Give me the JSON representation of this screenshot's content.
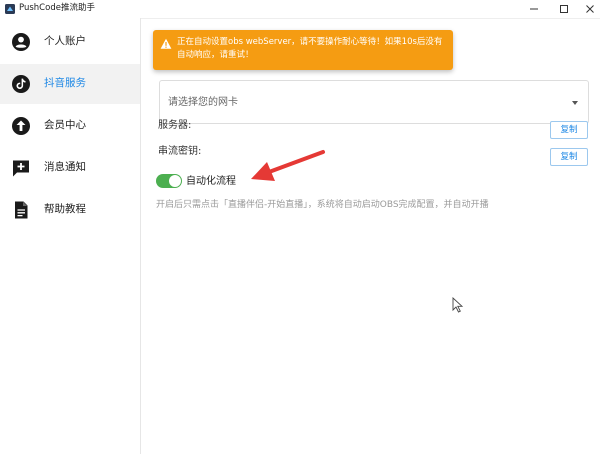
{
  "window": {
    "title": "PushCode推流助手",
    "controls": [
      "minimize",
      "maximize",
      "close"
    ]
  },
  "sidebar": {
    "items": [
      {
        "label": "个人账户",
        "icon": "account-icon",
        "active": false
      },
      {
        "label": "抖音服务",
        "icon": "tiktok-icon",
        "active": true
      },
      {
        "label": "会员中心",
        "icon": "upload-icon",
        "active": false
      },
      {
        "label": "消息通知",
        "icon": "message-plus-icon",
        "active": false
      },
      {
        "label": "帮助教程",
        "icon": "document-icon",
        "active": false
      }
    ]
  },
  "alert": {
    "text": "正在自动设置obs webServer，请不要操作耐心等待！如果10s后没有自动响应，请重试！",
    "icon": "warning-icon"
  },
  "network": {
    "placeholder": "请选择您的网卡"
  },
  "server": {
    "label": "服务器:",
    "copy_label": "复制"
  },
  "stream_key": {
    "label": "串流密钥:",
    "copy_label": "复制"
  },
  "auto_flow": {
    "label": "自动化流程",
    "enabled": true,
    "hint": "开启后只需点击「直播伴侣-开始直播」，系统将自动启动OBS完成配置，并自动开播"
  },
  "colors": {
    "accent": "#1e88e5",
    "alert": "#f59c12",
    "toggle_on": "#4caf50",
    "annotation_arrow": "#e53935"
  }
}
